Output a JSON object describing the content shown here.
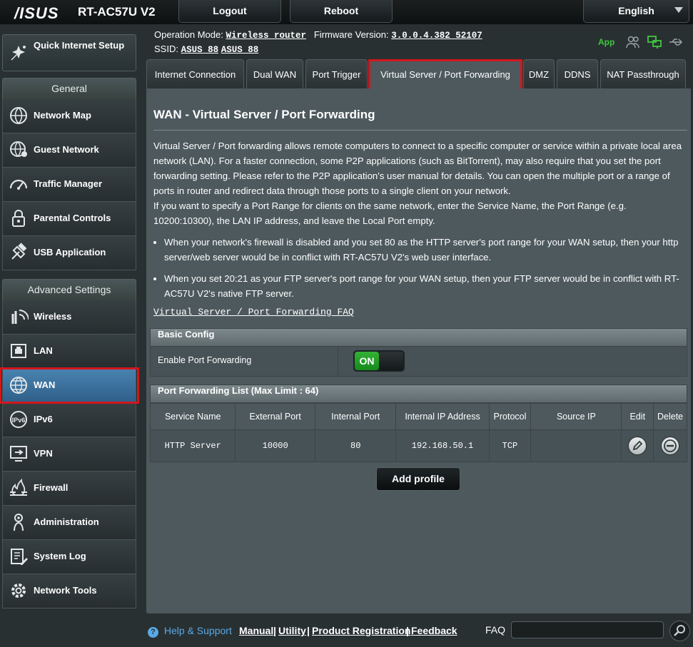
{
  "header": {
    "logo": "/ISUS",
    "model": "RT-AC57U V2",
    "logout_label": "Logout",
    "reboot_label": "Reboot",
    "language": "English"
  },
  "info": {
    "op_mode_label": "Operation Mode:",
    "op_mode_value": "Wireless router",
    "firmware_label": "Firmware Version:",
    "firmware_value": "3.0.0.4.382_52107",
    "ssid_label": "SSID:",
    "ssid_1": "ASUS_88",
    "ssid_2": "ASUS_88",
    "app_label": "App"
  },
  "sidebar": {
    "quick_setup": "Quick Internet Setup",
    "general_heading": "General",
    "general_items": [
      {
        "label": "Network Map",
        "icon": "network-map-icon"
      },
      {
        "label": "Guest Network",
        "icon": "guest-network-icon"
      },
      {
        "label": "Traffic Manager",
        "icon": "traffic-manager-icon"
      },
      {
        "label": "Parental Controls",
        "icon": "parental-controls-icon"
      },
      {
        "label": "USB Application",
        "icon": "usb-icon"
      }
    ],
    "advanced_heading": "Advanced Settings",
    "advanced_items": [
      {
        "label": "Wireless",
        "icon": "wireless-icon"
      },
      {
        "label": "LAN",
        "icon": "lan-icon"
      },
      {
        "label": "WAN",
        "icon": "globe-icon",
        "active": true
      },
      {
        "label": "IPv6",
        "icon": "ipv6-icon"
      },
      {
        "label": "VPN",
        "icon": "vpn-icon"
      },
      {
        "label": "Firewall",
        "icon": "firewall-icon"
      },
      {
        "label": "Administration",
        "icon": "administration-icon"
      },
      {
        "label": "System Log",
        "icon": "system-log-icon"
      },
      {
        "label": "Network Tools",
        "icon": "network-tools-icon"
      }
    ]
  },
  "tabs": [
    {
      "label": "Internet Connection"
    },
    {
      "label": "Dual WAN"
    },
    {
      "label": "Port Trigger"
    },
    {
      "label": "Virtual Server / Port Forwarding",
      "active": true
    },
    {
      "label": "DMZ"
    },
    {
      "label": "DDNS"
    },
    {
      "label": "NAT Passthrough"
    }
  ],
  "main": {
    "title": "WAN - Virtual Server / Port Forwarding",
    "desc_1": "Virtual Server / Port forwarding allows remote computers to connect to a specific computer or service within a private local area network (LAN). For a faster connection, some P2P applications (such as BitTorrent), may also require that you set the port forwarding setting. Please refer to the P2P application's user manual for details. You can open the multiple port or a range of ports in router and redirect data through those ports to a single client on your network.",
    "desc_2": "If you want to specify a Port Range for clients on the same network, enter the Service Name, the Port Range (e.g. 10200:10300), the LAN IP address, and leave the Local Port empty.",
    "bullet_1": "When your network's firewall is disabled and you set 80 as the HTTP server's port range for your WAN setup, then your http server/web server would be in conflict with RT-AC57U V2's web user interface.",
    "bullet_2": "When you set 20:21 as your FTP server's port range for your WAN setup, then your FTP server would be in conflict with RT-AC57U V2's native FTP server.",
    "faq_link": "Virtual Server / Port Forwarding FAQ",
    "basic_config_heading": "Basic Config",
    "enable_pf_label": "Enable Port Forwarding",
    "toggle_state": "ON",
    "pf_list_heading": "Port Forwarding List (Max Limit : 64)",
    "columns": [
      "Service Name",
      "External Port",
      "Internal Port",
      "Internal IP Address",
      "Protocol",
      "Source IP",
      "Edit",
      "Delete"
    ],
    "rows": [
      {
        "service": "HTTP Server",
        "external": "10000",
        "internal": "80",
        "ip": "192.168.50.1",
        "protocol": "TCP",
        "source": ""
      }
    ],
    "add_profile_label": "Add profile"
  },
  "footer": {
    "help_label": "Help & Support",
    "manual": "Manual",
    "utility": "Utility",
    "registration": "Product Registration",
    "feedback": "Feedback",
    "faq_label": "FAQ",
    "search_placeholder": ""
  },
  "colors": {
    "background": "#283032",
    "panel": "#4d595d",
    "active_menu": "#3b72a0",
    "highlight_border": "#d4161c",
    "toggle_on": "#2aa32a",
    "app_green": "#3ec83e",
    "help_blue": "#5aa9e6"
  }
}
